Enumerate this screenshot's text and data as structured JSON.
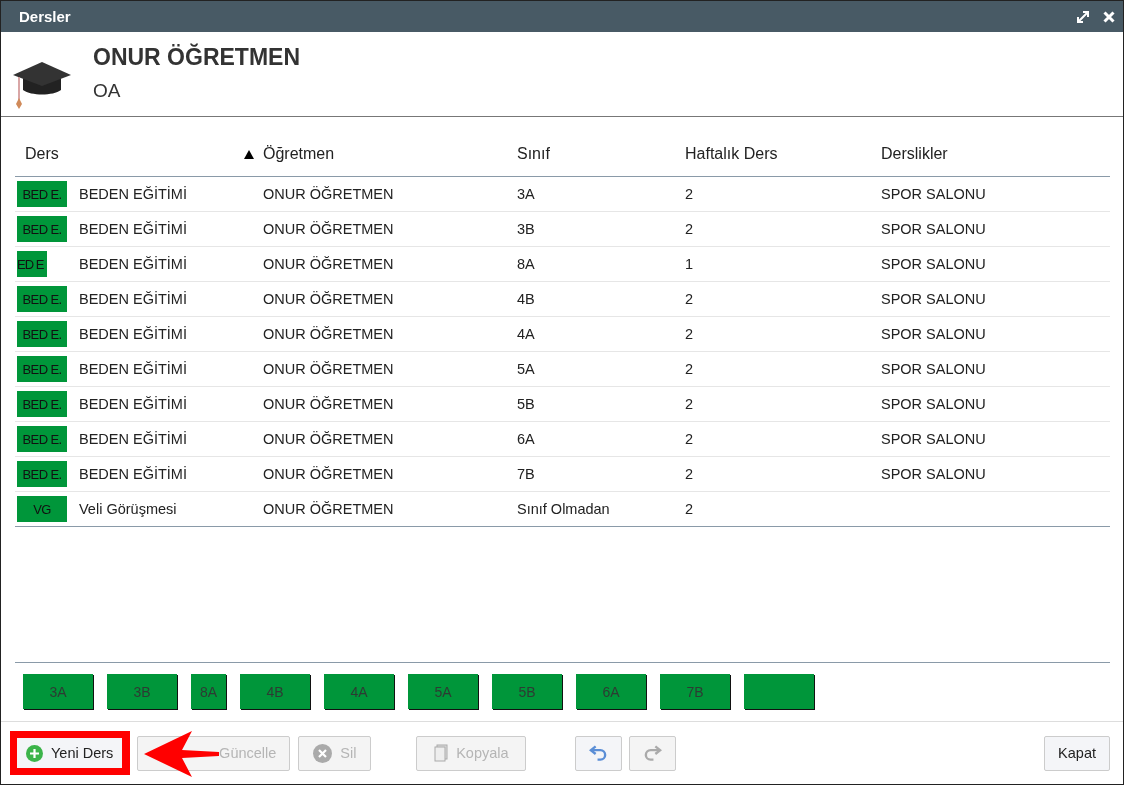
{
  "window": {
    "title": "Dersler"
  },
  "header": {
    "name": "ONUR ÖĞRETMEN",
    "code": "OA"
  },
  "table": {
    "columns": [
      {
        "label": "Ders",
        "sorted": true
      },
      {
        "label": "Öğretmen",
        "sorted": false
      },
      {
        "label": "Sınıf",
        "sorted": false
      },
      {
        "label": "Haftalık Ders",
        "sorted": false
      },
      {
        "label": "Derslikler",
        "sorted": false
      }
    ],
    "rows": [
      {
        "tag": "BED E.",
        "kind": "normal",
        "lesson": "BEDEN EĞİTİMİ",
        "teacher": "ONUR ÖĞRETMEN",
        "class": "3A",
        "weekly": "2",
        "rooms": "SPOR SALONU"
      },
      {
        "tag": "BED E.",
        "kind": "normal",
        "lesson": "BEDEN EĞİTİMİ",
        "teacher": "ONUR ÖĞRETMEN",
        "class": "3B",
        "weekly": "2",
        "rooms": "SPOR SALONU"
      },
      {
        "tag": "ED E",
        "kind": "narrow",
        "lesson": "BEDEN EĞİTİMİ",
        "teacher": "ONUR ÖĞRETMEN",
        "class": "8A",
        "weekly": "1",
        "rooms": "SPOR SALONU"
      },
      {
        "tag": "BED E.",
        "kind": "normal",
        "lesson": "BEDEN EĞİTİMİ",
        "teacher": "ONUR ÖĞRETMEN",
        "class": "4B",
        "weekly": "2",
        "rooms": "SPOR SALONU"
      },
      {
        "tag": "BED E.",
        "kind": "normal",
        "lesson": "BEDEN EĞİTİMİ",
        "teacher": "ONUR ÖĞRETMEN",
        "class": "4A",
        "weekly": "2",
        "rooms": "SPOR SALONU"
      },
      {
        "tag": "BED E.",
        "kind": "normal",
        "lesson": "BEDEN EĞİTİMİ",
        "teacher": "ONUR ÖĞRETMEN",
        "class": "5A",
        "weekly": "2",
        "rooms": "SPOR SALONU"
      },
      {
        "tag": "BED E.",
        "kind": "normal",
        "lesson": "BEDEN EĞİTİMİ",
        "teacher": "ONUR ÖĞRETMEN",
        "class": "5B",
        "weekly": "2",
        "rooms": "SPOR SALONU"
      },
      {
        "tag": "BED E.",
        "kind": "normal",
        "lesson": "BEDEN EĞİTİMİ",
        "teacher": "ONUR ÖĞRETMEN",
        "class": "6A",
        "weekly": "2",
        "rooms": "SPOR SALONU"
      },
      {
        "tag": "BED E.",
        "kind": "normal",
        "lesson": "BEDEN EĞİTİMİ",
        "teacher": "ONUR ÖĞRETMEN",
        "class": "7B",
        "weekly": "2",
        "rooms": "SPOR SALONU"
      },
      {
        "tag": "VG",
        "kind": "normal",
        "lesson": "Veli Görüşmesi",
        "teacher": "ONUR ÖĞRETMEN",
        "class": "Sınıf Olmadan",
        "weekly": "2"
      }
    ]
  },
  "class_tiles": [
    {
      "label": "3A",
      "kind": "wide"
    },
    {
      "label": "3B",
      "kind": "wide"
    },
    {
      "label": "8A",
      "kind": "narrow"
    },
    {
      "label": "4B",
      "kind": "wide"
    },
    {
      "label": "4A",
      "kind": "wide"
    },
    {
      "label": "5A",
      "kind": "wide"
    },
    {
      "label": "5B",
      "kind": "wide"
    },
    {
      "label": "6A",
      "kind": "wide"
    },
    {
      "label": "7B",
      "kind": "wide"
    },
    {
      "kind": "wide"
    }
  ],
  "buttons": [
    {
      "kind": "add",
      "label": "Yeni Ders",
      "disabled": false,
      "highlighted": true
    },
    {
      "kind": "edit",
      "label": "Güncelle",
      "disabled": true,
      "highlighted": false
    },
    {
      "kind": "delete",
      "label": "Sil",
      "disabled": true,
      "highlighted": false
    },
    {
      "kind": "copy",
      "label": "Kopyala",
      "disabled": true,
      "highlighted": false
    },
    {
      "kind": "undo",
      "disabled": false,
      "highlighted": false
    },
    {
      "kind": "redo",
      "disabled": true,
      "highlighted": false
    },
    {
      "kind": "close",
      "label": "Kapat",
      "disabled": false,
      "highlighted": false
    }
  ]
}
